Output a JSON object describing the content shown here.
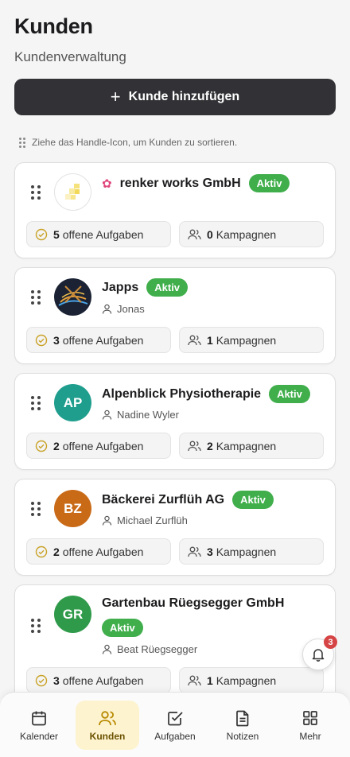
{
  "header": {
    "title": "Kunden",
    "subtitle": "Kundenverwaltung"
  },
  "add_button": {
    "label": "Kunde hinzufügen"
  },
  "hint": "Ziehe das Handle-Icon, um Kunden zu sortieren.",
  "customers": [
    {
      "name": "renker works GmbH",
      "status": "Aktiv",
      "contact": "",
      "tasks_count": "5",
      "tasks_label": "offene Aufgaben",
      "campaigns_count": "0",
      "campaigns_label": "Kampagnen"
    },
    {
      "name": "Japps",
      "status": "Aktiv",
      "contact": "Jonas",
      "tasks_count": "3",
      "tasks_label": "offene Aufgaben",
      "campaigns_count": "1",
      "campaigns_label": "Kampagnen"
    },
    {
      "name": "Alpenblick Physiotherapie",
      "status": "Aktiv",
      "contact": "Nadine Wyler",
      "initials": "AP",
      "tasks_count": "2",
      "tasks_label": "offene Aufgaben",
      "campaigns_count": "2",
      "campaigns_label": "Kampagnen"
    },
    {
      "name": "Bäckerei Zurflüh AG",
      "status": "Aktiv",
      "contact": "Michael Zurflüh",
      "initials": "BZ",
      "tasks_count": "2",
      "tasks_label": "offene Aufgaben",
      "campaigns_count": "3",
      "campaigns_label": "Kampagnen"
    },
    {
      "name": "Gartenbau Rüegsegger GmbH",
      "status": "Aktiv",
      "contact": "Beat Rüegsegger",
      "initials": "GR",
      "tasks_count": "3",
      "tasks_label": "offene Aufgaben",
      "campaigns_count": "1",
      "campaigns_label": "Kampagnen"
    }
  ],
  "notifications": {
    "count": "3",
    "icon": "bell-icon"
  },
  "tabs": [
    {
      "label": "Kalender",
      "icon": "calendar-icon"
    },
    {
      "label": "Kunden",
      "icon": "users-icon",
      "active": true
    },
    {
      "label": "Aufgaben",
      "icon": "checkbox-icon"
    },
    {
      "label": "Notizen",
      "icon": "document-icon"
    },
    {
      "label": "Mehr",
      "icon": "grid-icon"
    }
  ],
  "colors": {
    "accent_dark": "#323236",
    "status_green": "#3fae4b",
    "tab_active_bg": "#fdf3cf",
    "badge_red": "#d64545"
  }
}
